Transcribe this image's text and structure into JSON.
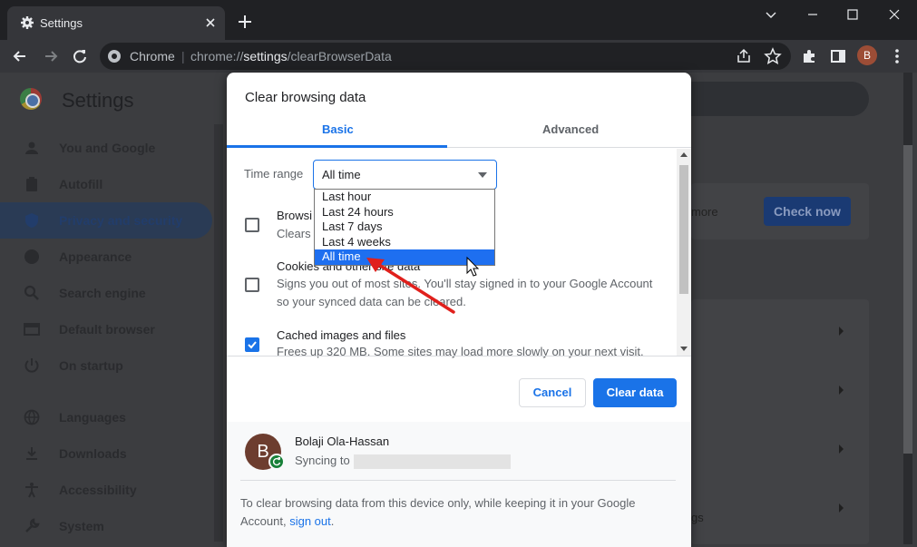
{
  "tab": {
    "title": "Settings",
    "icon": "gear-icon"
  },
  "omnibox": {
    "site": "Chrome",
    "separator": "|",
    "url_prefix": "chrome://",
    "url_host": "settings",
    "url_path": "/clearBrowserData"
  },
  "profile_initial": "B",
  "page": {
    "title": "Settings",
    "sidebar": [
      {
        "label": "You and Google",
        "icon": "person-icon"
      },
      {
        "label": "Autofill",
        "icon": "clipboard-icon"
      },
      {
        "label": "Privacy and security",
        "icon": "shield-icon"
      },
      {
        "label": "Appearance",
        "icon": "palette-icon"
      },
      {
        "label": "Search engine",
        "icon": "search-icon"
      },
      {
        "label": "Default browser",
        "icon": "browser-window-icon"
      },
      {
        "label": "On startup",
        "icon": "power-icon"
      },
      {
        "label": "Languages",
        "icon": "globe-icon"
      },
      {
        "label": "Downloads",
        "icon": "download-icon"
      },
      {
        "label": "Accessibility",
        "icon": "accessibility-icon"
      },
      {
        "label": "System",
        "icon": "wrench-icon"
      }
    ],
    "partial_text": "more",
    "check_now": "Check now",
    "partial_text_2": "gs"
  },
  "dialog": {
    "title": "Clear browsing data",
    "tabs": {
      "basic": "Basic",
      "advanced": "Advanced"
    },
    "time_range_label": "Time range",
    "time_range_value": "All time",
    "items": [
      {
        "title": "Browsi",
        "desc": "Clears",
        "checked": false
      },
      {
        "title": "Cookies and other site data",
        "desc": "Signs you out of most sites. You'll stay signed in to your Google Account so your synced data can be cleared.",
        "checked": false
      },
      {
        "title": "Cached images and files",
        "desc": "Frees up 320 MB. Some sites may load more slowly on your next visit.",
        "checked": true
      }
    ],
    "cancel": "Cancel",
    "clear": "Clear data",
    "user_name": "Bolaji Ola-Hassan",
    "syncing": "Syncing to",
    "footer_text": "To clear browsing data from this device only, while keeping it in your Google Account, ",
    "footer_link": "sign out",
    "footer_end": "."
  },
  "dropdown": {
    "options": [
      "Last hour",
      "Last 24 hours",
      "Last 7 days",
      "Last 4 weeks",
      "All time"
    ],
    "selected": "All time"
  },
  "colors": {
    "accent": "#1a73e8",
    "annotation_arrow": "#e0201c"
  }
}
